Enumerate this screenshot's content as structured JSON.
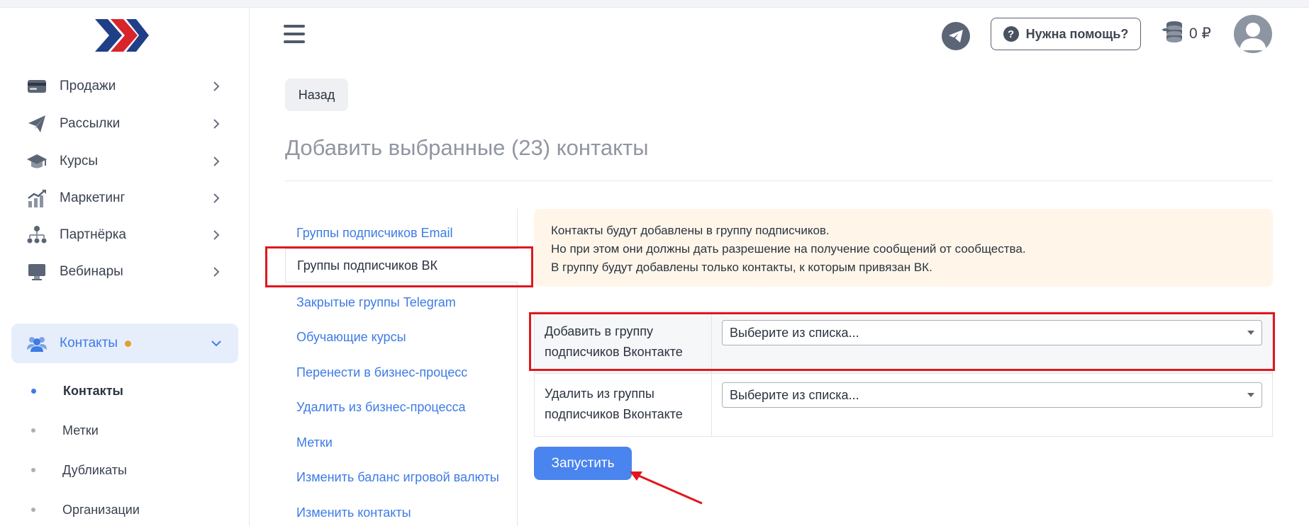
{
  "sidebar": {
    "items": [
      {
        "label": "Продажи",
        "icon": "card-icon"
      },
      {
        "label": "Рассылки",
        "icon": "paper-plane-icon"
      },
      {
        "label": "Курсы",
        "icon": "graduation-cap-icon"
      },
      {
        "label": "Маркетинг",
        "icon": "chart-growth-icon"
      },
      {
        "label": "Партнёрка",
        "icon": "org-tree-icon"
      },
      {
        "label": "Вебинары",
        "icon": "monitor-icon"
      },
      {
        "label": "Контакты",
        "icon": "users-icon"
      }
    ],
    "sub_items": [
      {
        "label": "Контакты"
      },
      {
        "label": "Метки"
      },
      {
        "label": "Дубликаты"
      },
      {
        "label": "Организации"
      }
    ]
  },
  "header": {
    "help_label": "Нужна помощь?",
    "balance": "0 ₽"
  },
  "content": {
    "back_label": "Назад",
    "title": "Добавить выбранные (23) контакты",
    "tabs": [
      {
        "label": "Группы подписчиков Email"
      },
      {
        "label": "Группы подписчиков ВК"
      },
      {
        "label": "Закрытые группы Telegram"
      },
      {
        "label": "Обучающие курсы"
      },
      {
        "label": "Перенести в бизнес-процесс"
      },
      {
        "label": "Удалить из бизнес-процесса"
      },
      {
        "label": "Метки"
      },
      {
        "label": "Изменить баланс игровой валюты"
      },
      {
        "label": "Изменить контакты"
      }
    ],
    "notice": [
      "Контакты будут добавлены в группу подписчиков.",
      "Но при этом они должны дать разрешение на получение сообщений от сообщества.",
      "В группу будут добавлены только контакты, к которым привязан ВК."
    ],
    "form": [
      {
        "label_l1": "Добавить в группу",
        "label_l2": "подписчиков Вконтакте",
        "select": "Выберите из списка..."
      },
      {
        "label_l1": "Удалить из группы",
        "label_l2": "подписчиков Вконтакте",
        "select": "Выберите из списка..."
      }
    ],
    "run_label": "Запустить"
  },
  "colors": {
    "accent": "#4a84ee",
    "link": "#3d7be6",
    "highlight": "#e0171e",
    "notice_bg": "#fff6e9",
    "active_nav_bg": "#e6eefc",
    "badge": "#e3a02c"
  }
}
